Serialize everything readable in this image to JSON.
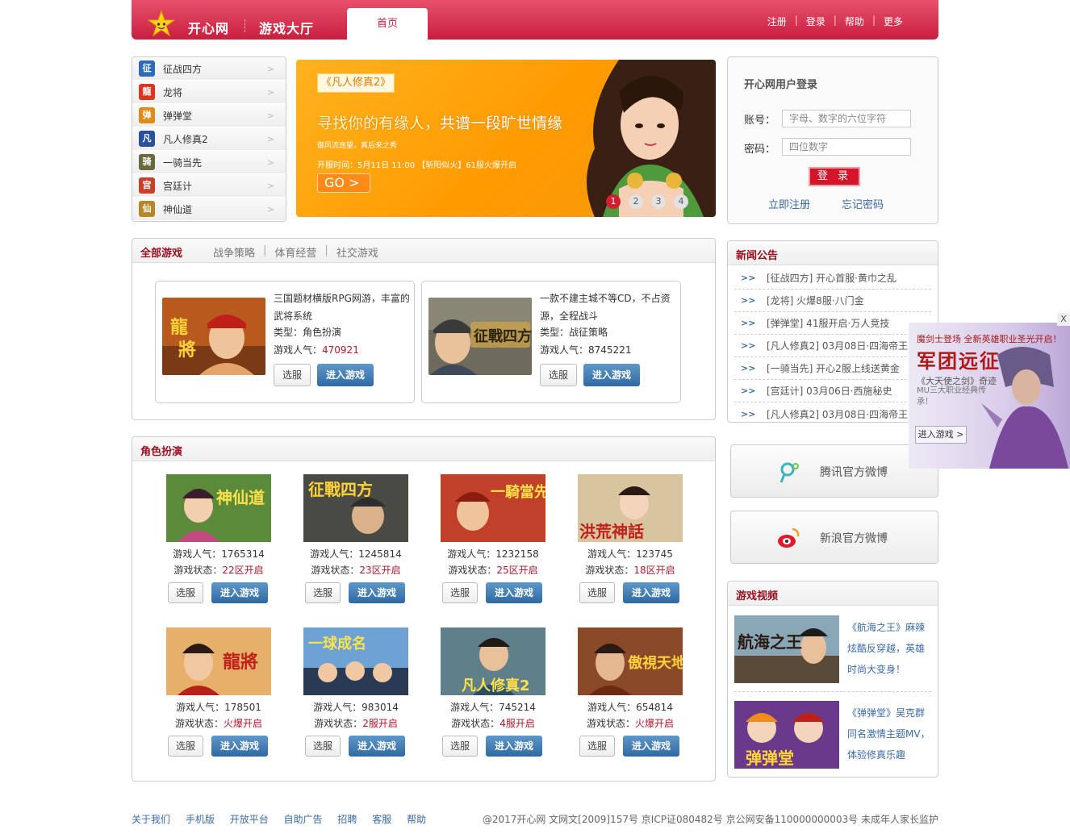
{
  "header": {
    "brand": "开心网",
    "hall": "游戏大厅",
    "tab_home": "首页",
    "links": [
      "注册",
      "登录",
      "帮助",
      "更多"
    ],
    "accent": "#c8203f"
  },
  "game_list": [
    {
      "label": "征战四方",
      "icon": "zheng-icon",
      "glyph": "征",
      "color": "#2b6bb8"
    },
    {
      "label": "龙将",
      "icon": "long-icon",
      "glyph": "龍",
      "color": "#d9351f"
    },
    {
      "label": "弹弹堂",
      "icon": "bomb-icon",
      "glyph": "弹",
      "color": "#e08a18"
    },
    {
      "label": "凡人修真2",
      "icon": "fan-icon",
      "glyph": "凡",
      "color": "#2a4f9b"
    },
    {
      "label": "一骑当先",
      "icon": "horse-icon",
      "glyph": "骑",
      "color": "#6a6a40"
    },
    {
      "label": "宫廷计",
      "icon": "palace-icon",
      "glyph": "宫",
      "color": "#c8402a"
    },
    {
      "label": "神仙道",
      "icon": "gourd-icon",
      "glyph": "仙",
      "color": "#b8862a"
    }
  ],
  "banner": {
    "tag": "《凡人修真2》",
    "slogan_a": "寻找你的有缘人，",
    "slogan_b": "共谱一段旷世情缘",
    "sub": "御风流逸望，真后来之秀",
    "open": "开服时间：5月11日 11:00 【斩阳似火】61服火爆开启",
    "go": "GO >",
    "dots": [
      "1",
      "2",
      "3",
      "4"
    ]
  },
  "login": {
    "title": "开心网用户登录",
    "account_label": "账号：",
    "account_placeholder": "字母、数字的六位字符",
    "password_label": "密码：",
    "password_placeholder": "四位数字",
    "login_btn": "登 录",
    "register": "立即注册",
    "forgot": "忘记密码"
  },
  "all_games": {
    "title": "全部游戏",
    "tabs": [
      "战争策略",
      "体育经营",
      "社交游戏"
    ],
    "cards": [
      {
        "desc": "三国题材横版RPG网游，丰富的武将系统",
        "type": "类型：角色扮演",
        "pop_label": "游戏人气：",
        "pop": "470921",
        "select": "选服",
        "enter": "进入游戏"
      },
      {
        "desc": "一款不建主城不等CD，不占资源，全程战斗",
        "type": "类型：战征策略",
        "pop_label": "游戏人气：",
        "pop": "8745221",
        "select": "选服",
        "enter": "进入游戏"
      }
    ]
  },
  "role_play": {
    "title": "角色扮演",
    "games": [
      {
        "pop": "游戏人气：1765314",
        "status_label": "游戏状态：",
        "status": "22区开启",
        "select": "选服",
        "enter": "进入游戏"
      },
      {
        "pop": "游戏人气：1245814",
        "status_label": "游戏状态：",
        "status": "23区开启",
        "select": "选服",
        "enter": "进入游戏"
      },
      {
        "pop": "游戏人气：1232158",
        "status_label": "游戏状态：",
        "status": "25区开启",
        "select": "选服",
        "enter": "进入游戏"
      },
      {
        "pop": "游戏人气：123745",
        "status_label": "游戏状态：",
        "status": "18区开启",
        "select": "选服",
        "enter": "进入游戏"
      },
      {
        "pop": "游戏人气：178501",
        "status_label": "游戏状态：",
        "status": "火爆开启",
        "select": "选服",
        "enter": "进入游戏"
      },
      {
        "pop": "游戏人气：983014",
        "status_label": "游戏状态：",
        "status": "2服开启",
        "select": "选服",
        "enter": "进入游戏"
      },
      {
        "pop": "游戏人气：745214",
        "status_label": "游戏状态：",
        "status": "4服开启",
        "select": "选服",
        "enter": "进入游戏"
      },
      {
        "pop": "游戏人气：654814",
        "status_label": "游戏状态：",
        "status": "火爆开启",
        "select": "选服",
        "enter": "进入游戏"
      }
    ]
  },
  "news": {
    "title": "新闻公告",
    "items": [
      "[征战四方] 开心首服·黄巾之乱",
      "[龙将] 火爆8服·八门金",
      "[弹弹堂] 41服开启·万人竞技",
      "[凡人修真2] 03月08日·四海帝王",
      "[一骑当先] 开心2服上线送黄金",
      "[宫廷计] 03月06日·西施秘史",
      "[凡人修真2] 03月08日·四海帝王"
    ]
  },
  "weibo": {
    "tencent": "腾讯官方微博",
    "sina": "新浪官方微博"
  },
  "videos": {
    "title": "游戏视频",
    "items": [
      {
        "text": "《航海之王》麻辣炫酷反穿越，英雄时尚大变身！"
      },
      {
        "text": "《弹弹堂》吴克群同名激情主题MV，体验修真乐趣"
      }
    ]
  },
  "ad": {
    "close": "X",
    "line1": "魔剑士登场 全新英雄职业圣光开启！",
    "headline": "军团远征",
    "line3": "《大天使之剑》奇迹",
    "line4": "MU三大职业经典传承！",
    "cta": "进入游戏 >"
  },
  "footer": {
    "links": [
      "关于我们",
      "手机版",
      "开放平台",
      "自助广告",
      "招聘",
      "客服",
      "帮助"
    ],
    "copyright": "@2017开心网  文网文[2009]157号  京ICP证080482号  京公网安备110000000003号 未成年人家长监护"
  }
}
